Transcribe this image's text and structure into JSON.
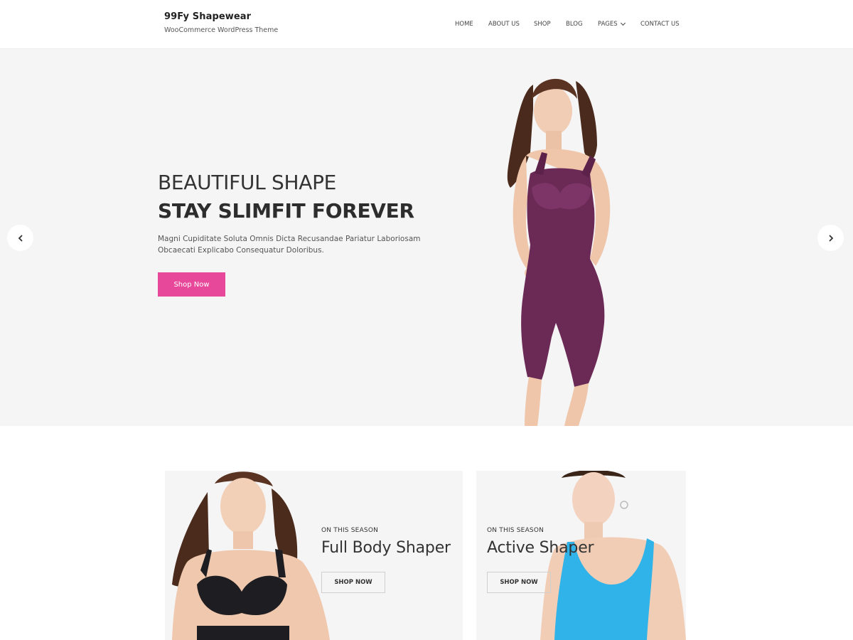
{
  "header": {
    "site_title": "99Fy Shapewear",
    "tagline": "WooCommerce WordPress Theme",
    "nav": [
      {
        "label": "HOME"
      },
      {
        "label": "ABOUT US"
      },
      {
        "label": "SHOP"
      },
      {
        "label": "BLOG"
      },
      {
        "label": "PAGES"
      },
      {
        "label": "CONTACT US"
      }
    ]
  },
  "hero": {
    "line1": "BEAUTIFUL SHAPE",
    "line2": "STAY SLIMFIT FOREVER",
    "description": "Magni Cupiditate Soluta Omnis Dicta Recusandae Pariatur Laboriosam Obcaecati Explicabo Consequatur Doloribus.",
    "button_label": "Shop Now",
    "button_color": "#e8489a",
    "background": "#f5f5f6",
    "garment_color": "#6b2a56"
  },
  "cards": [
    {
      "eyebrow": "ON THIS SEASON",
      "title": "Full Body Shaper",
      "button_label": "SHOP NOW",
      "garment_color": "#1e1e22"
    },
    {
      "eyebrow": "ON THIS SEASON",
      "title": "Active Shaper",
      "button_label": "SHOP NOW",
      "garment_color": "#2fb3e8"
    }
  ],
  "icons": {
    "prev": "chevron-left-icon",
    "next": "chevron-right-icon",
    "pages_dropdown": "chevron-down-icon"
  }
}
